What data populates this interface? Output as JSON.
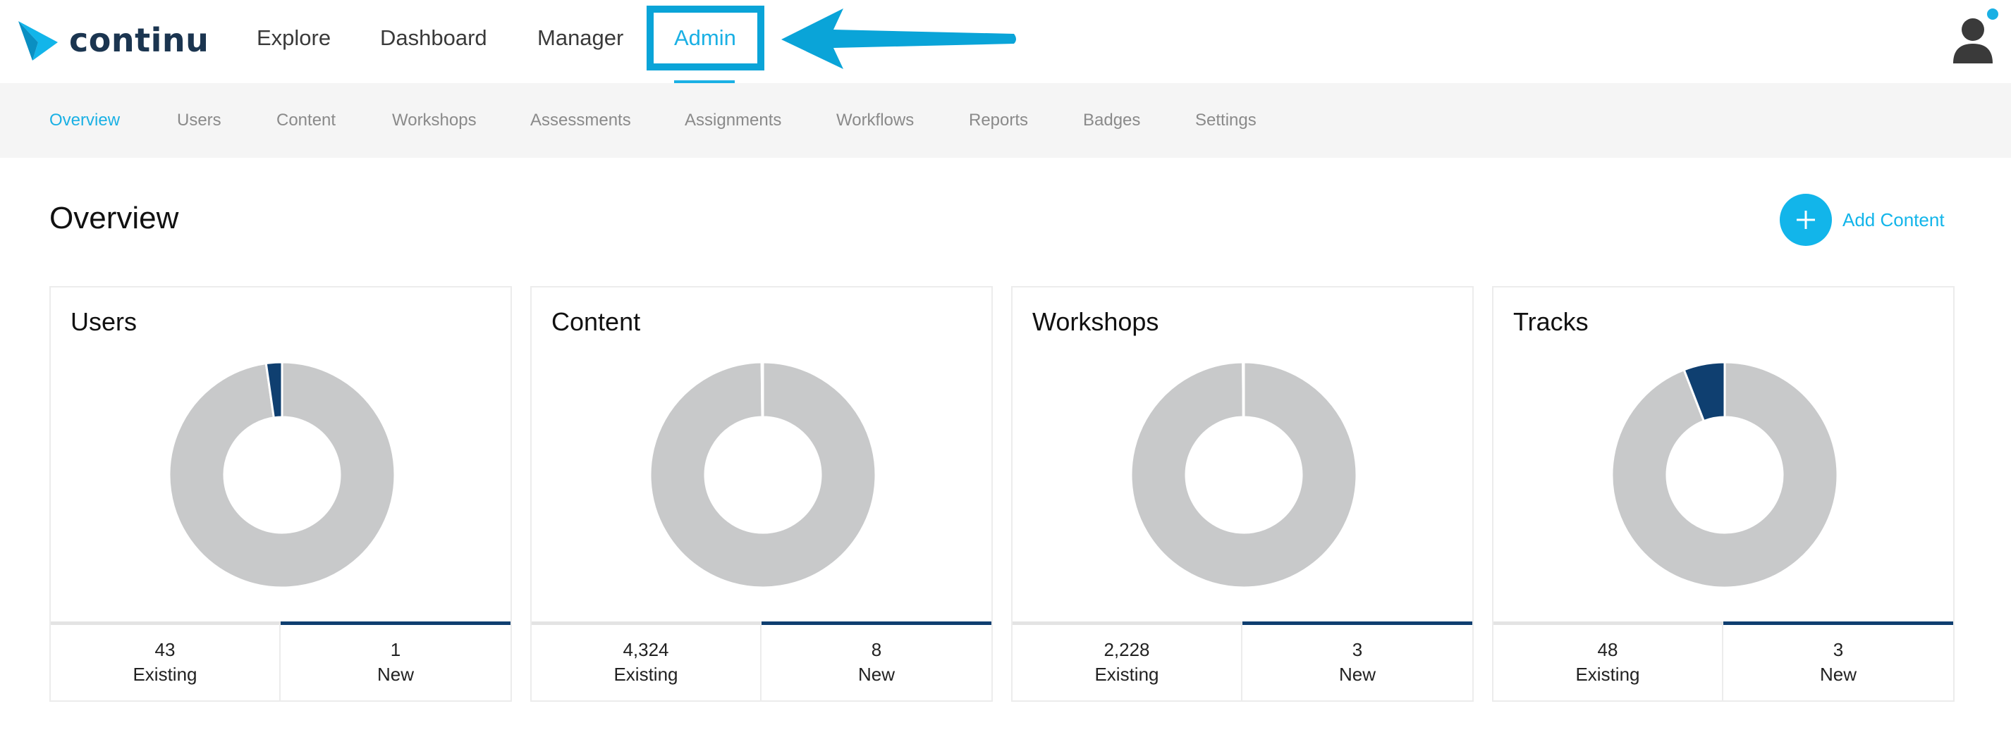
{
  "app": {
    "logo_text": "continu"
  },
  "nav": {
    "items": [
      {
        "label": "Explore"
      },
      {
        "label": "Dashboard"
      },
      {
        "label": "Manager"
      },
      {
        "label": "Admin"
      }
    ]
  },
  "subnav": {
    "items": [
      {
        "label": "Overview"
      },
      {
        "label": "Users"
      },
      {
        "label": "Content"
      },
      {
        "label": "Workshops"
      },
      {
        "label": "Assessments"
      },
      {
        "label": "Assignments"
      },
      {
        "label": "Workflows"
      },
      {
        "label": "Reports"
      },
      {
        "label": "Badges"
      },
      {
        "label": "Settings"
      }
    ]
  },
  "page": {
    "title": "Overview",
    "add_content_label": "Add Content"
  },
  "cards": [
    {
      "title": "Users",
      "existing_value": "43",
      "existing_label": "Existing",
      "new_value": "1",
      "new_label": "New",
      "existing": 43,
      "new": 1
    },
    {
      "title": "Content",
      "existing_value": "4,324",
      "existing_label": "Existing",
      "new_value": "8",
      "new_label": "New",
      "existing": 4324,
      "new": 8
    },
    {
      "title": "Workshops",
      "existing_value": "2,228",
      "existing_label": "Existing",
      "new_value": "3",
      "new_label": "New",
      "existing": 2228,
      "new": 3
    },
    {
      "title": "Tracks",
      "existing_value": "48",
      "existing_label": "Existing",
      "new_value": "3",
      "new_label": "New",
      "existing": 48,
      "new": 3
    }
  ],
  "colors": {
    "accent": "#1ab0e4",
    "existing_slice": "#c8c9ca",
    "new_slice": "#0f3f70",
    "annotation": "#0aa4d8"
  }
}
